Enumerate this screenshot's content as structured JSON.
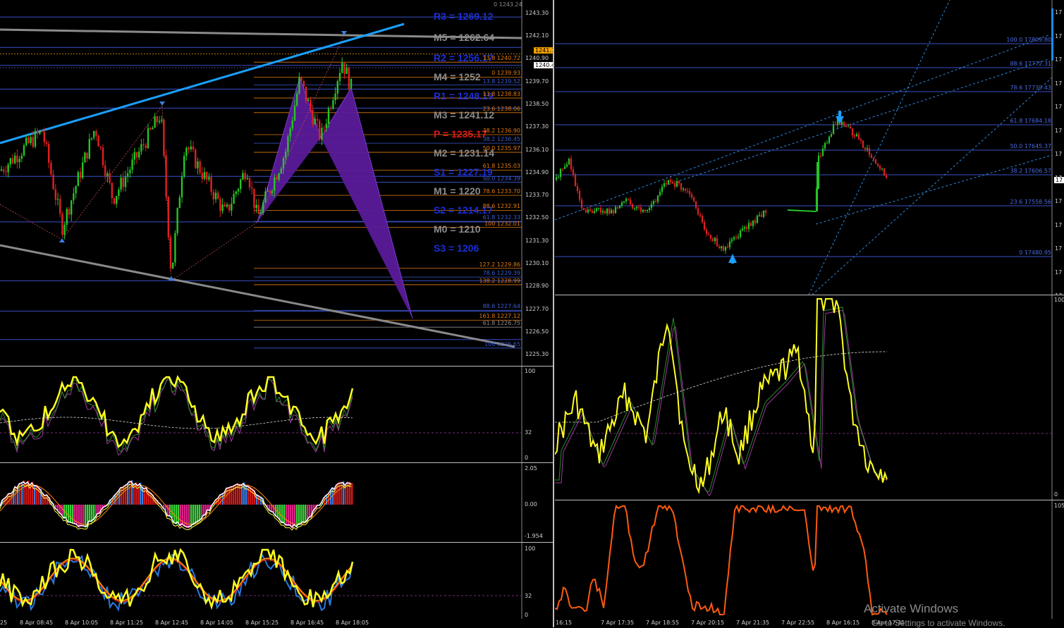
{
  "left_chart": {
    "price_axis": [
      "1243.30",
      "1242.10",
      "1240.90",
      "1239.70",
      "1238.50",
      "1237.30",
      "1236.10",
      "1234.90",
      "1233.70",
      "1232.50",
      "1231.30",
      "1230.10",
      "1228.90",
      "1227.70",
      "1226.50",
      "1225.30"
    ],
    "price_range": [
      1224.9,
      1243.7
    ],
    "tags": {
      "ask": "1241.15",
      "bid": "1240.43"
    },
    "top_level": "0 1243.24",
    "pivots": [
      {
        "label": "R3 = 1269.12",
        "color": "#1a2fd8",
        "price": 1243.1
      },
      {
        "label": "M5 = 1262.64",
        "color": "#8c8c8c",
        "price": 1242.0
      },
      {
        "label": "R2 = 1256.17",
        "color": "#1a2fd8",
        "price": 1240.9
      },
      {
        "label": "M4 = 1252",
        "color": "#8c8c8c",
        "price": 1239.9
      },
      {
        "label": "R1 = 1248.19",
        "color": "#1a2fd8",
        "price": 1238.9
      },
      {
        "label": "M3 = 1241.12",
        "color": "#8c8c8c",
        "price": 1237.9
      },
      {
        "label": "P  = 1235.17",
        "color": "#e01818",
        "price": 1236.9
      },
      {
        "label": "M2 = 1231.14",
        "color": "#8c8c8c",
        "price": 1235.9
      },
      {
        "label": "S1 = 1227.19",
        "color": "#1a2fd8",
        "price": 1234.9
      },
      {
        "label": "M1 = 1220",
        "color": "#8c8c8c",
        "price": 1233.9
      },
      {
        "label": "S2 = 1214.17",
        "color": "#1a2fd8",
        "price": 1232.9
      },
      {
        "label": "M0 = 1210",
        "color": "#8c8c8c",
        "price": 1231.9
      },
      {
        "label": "S3 = 1206",
        "color": "#1a2fd8",
        "price": 1230.9
      }
    ],
    "fib_levels": [
      {
        "label": "13.8 1240.72",
        "price": 1240.72,
        "color": "#e07a10"
      },
      {
        "label": "0 1239.93",
        "price": 1239.93,
        "color": "#e07a10"
      },
      {
        "label": "13.8 1239.52",
        "price": 1239.52,
        "color": "#3a5bd0"
      },
      {
        "label": "13.8 1238.83",
        "price": 1238.83,
        "color": "#e07a10"
      },
      {
        "label": "23.6 1238.06",
        "price": 1238.06,
        "color": "#e07a10"
      },
      {
        "label": "38.2 1236.90",
        "price": 1236.9,
        "color": "#e07a10"
      },
      {
        "label": "38.2 1236.45",
        "price": 1236.45,
        "color": "#3a5bd0"
      },
      {
        "label": "50.0 1235.97",
        "price": 1235.97,
        "color": "#e07a10"
      },
      {
        "label": "61.8 1235.03",
        "price": 1235.03,
        "color": "#e07a10"
      },
      {
        "label": "50.0 1234.39",
        "price": 1234.39,
        "color": "#3a5bd0"
      },
      {
        "label": "78.6 1233.70",
        "price": 1233.7,
        "color": "#e07a10"
      },
      {
        "label": "88.6 1232.91",
        "price": 1232.91,
        "color": "#e07a10"
      },
      {
        "label": "61.8 1232.33",
        "price": 1232.33,
        "color": "#3a5bd0"
      },
      {
        "label": "100 1232.01",
        "price": 1232.01,
        "color": "#e07a10"
      },
      {
        "label": "127.2 1229.86",
        "price": 1229.86,
        "color": "#e07a10"
      },
      {
        "label": "78.6 1229.39",
        "price": 1229.39,
        "color": "#3a5bd0"
      },
      {
        "label": "138.2 1228.99",
        "price": 1228.99,
        "color": "#e07a10"
      },
      {
        "label": "88.6 1227.64",
        "price": 1227.64,
        "color": "#3a5bd0"
      },
      {
        "label": "161.8 1227.12",
        "price": 1227.12,
        "color": "#e07a10"
      },
      {
        "label": "61.8 1226.75",
        "price": 1226.75,
        "color": "#8c8c8c"
      },
      {
        "label": "100 1225.65",
        "price": 1225.65,
        "color": "#3a5bd0"
      }
    ],
    "osc1_axis": [
      "100",
      "32",
      "0"
    ],
    "osc2_axis": [
      "2.05",
      "0.00",
      "-1.954"
    ],
    "osc3_axis": [
      "100",
      "32",
      "0"
    ],
    "time_axis": [
      "8 Apr 08:45",
      "8 Apr 10:05",
      "8 Apr 11:25",
      "8 Apr 12:45",
      "8 Apr 14:05",
      "8 Apr 15:25",
      "8 Apr 16:45",
      "8 Apr 18:05"
    ],
    "time_axis_first": "25"
  },
  "right_chart": {
    "price_axis": [
      "17",
      "17",
      "17",
      "17",
      "17",
      "17",
      "17",
      "17",
      "17",
      "17",
      "17",
      "17",
      "17"
    ],
    "tag": "17",
    "fib_levels": [
      {
        "label": "100.0 17809.80",
        "color": "#4a6ae0"
      },
      {
        "label": "88.6 17772.31",
        "color": "#4a6ae0"
      },
      {
        "label": "78.6 17739.43",
        "color": "#4a6ae0"
      },
      {
        "label": "61.8 17684.18",
        "color": "#4a6ae0"
      },
      {
        "label": "50.0 17645.37",
        "color": "#4a6ae0"
      },
      {
        "label": "38.2 17606.57",
        "color": "#4a6ae0"
      },
      {
        "label": "23.6 17558.56",
        "color": "#4a6ae0"
      },
      {
        "label": "0 17480.95",
        "color": "#4a6ae0"
      }
    ],
    "osc1_axis": [
      "100",
      "0"
    ],
    "osc2_axis": [
      "105"
    ],
    "time_axis": [
      "16:15",
      "7 Apr 17:35",
      "7 Apr 18:55",
      "7 Apr 20:15",
      "7 Apr 21:35",
      "7 Apr 22:55",
      "8 Apr 16:15",
      "8 Apr 17:35"
    ]
  },
  "watermark": {
    "line1": "Activate Windows",
    "line2": "Go to Settings to activate Windows."
  },
  "colors": {
    "bull": "#26c426",
    "bear": "#e02020",
    "cyan": "#1aa0ff",
    "purple": "#5a1a9a",
    "yellow": "#ffff20",
    "orange": "#ff5a10"
  }
}
